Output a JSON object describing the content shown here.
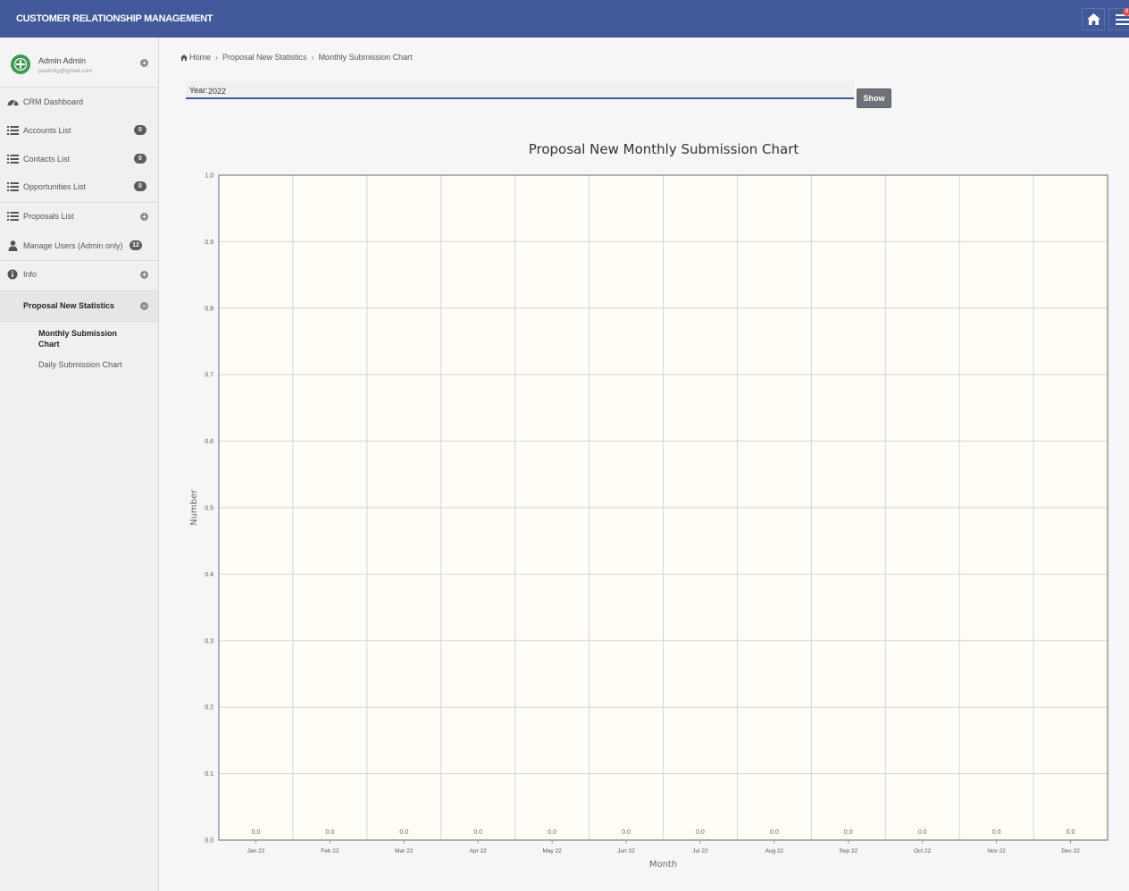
{
  "header": {
    "title": "CUSTOMER RELATIONSHIP MANAGEMENT",
    "notification_count": "9"
  },
  "user": {
    "name": "Admin Admin",
    "email": "puaricky@gmail.com"
  },
  "sidebar": {
    "items": [
      {
        "label": "CRM Dashboard",
        "icon": "dashboard-icon"
      },
      {
        "label": "Accounts List",
        "icon": "list-icon",
        "badge": "0"
      },
      {
        "label": "Contacts List",
        "icon": "list-icon",
        "badge": "0"
      },
      {
        "label": "Opportunities List",
        "icon": "list-icon",
        "badge": "0"
      },
      {
        "label": "Proposals List",
        "icon": "list-icon"
      },
      {
        "label": "Manage Users (Admin only)",
        "icon": "user-icon",
        "badge": "12"
      },
      {
        "label": "Info",
        "icon": "info-icon"
      },
      {
        "label": "Proposal New Statistics"
      }
    ],
    "subitems": [
      {
        "label": "Monthly Submission Chart"
      },
      {
        "label": "Daily Submission Chart"
      }
    ]
  },
  "breadcrumb": {
    "home": "Home",
    "level1": "Proposal New Statistics",
    "level2": "Monthly Submission Chart"
  },
  "form": {
    "year_label": "Year:",
    "year_value": "2022",
    "show_label": "Show"
  },
  "colors": {
    "header": "#41589b",
    "plot_bg": "#fffdf5",
    "button": "#6c7278"
  },
  "chart_data": {
    "type": "bar",
    "title": "Proposal New Monthly Submission Chart",
    "xlabel": "Month",
    "ylabel": "Number",
    "categories": [
      "Jan 22",
      "Feb 22",
      "Mar 22",
      "Apr 22",
      "May 22",
      "Jun 22",
      "Jul 22",
      "Aug 22",
      "Sep 22",
      "Oct 22",
      "Nov 22",
      "Dec 22"
    ],
    "values": [
      0,
      0,
      0,
      0,
      0,
      0,
      0,
      0,
      0,
      0,
      0,
      0
    ],
    "data_labels": [
      "0.0",
      "0.0",
      "0.0",
      "0.0",
      "0.0",
      "0.0",
      "0.0",
      "0.0",
      "0.0",
      "0.0",
      "0.0",
      "0.0"
    ],
    "ylim": [
      0,
      1
    ],
    "yticks": [
      "0.0",
      "0.1",
      "0.2",
      "0.3",
      "0.4",
      "0.5",
      "0.6",
      "0.7",
      "0.8",
      "0.9",
      "1.0"
    ],
    "grid": true
  }
}
